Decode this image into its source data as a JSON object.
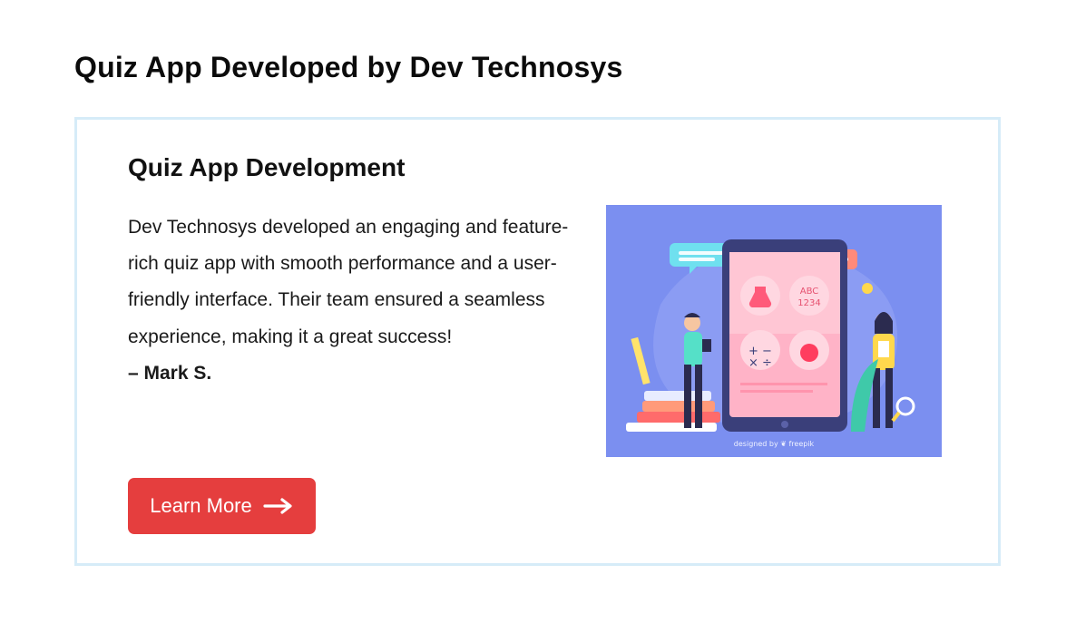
{
  "page": {
    "title": "Quiz App Developed by Dev Technosys"
  },
  "card": {
    "title": "Quiz App Development",
    "body": "Dev Technosys developed an engaging and feature-rich quiz app with smooth performance and a user-friendly interface. Their team ensured a seamless experience, making it a great success!",
    "author": "– Mark S.",
    "cta_label": "Learn More",
    "cta_icon": "arrow-right-icon"
  },
  "illustration": {
    "tile_text_top": "ABC",
    "tile_text_bottom": "1234",
    "credit": "designed by ❦ freepik"
  },
  "colors": {
    "accent": "#e53e3e",
    "card_border": "#d6ecf8",
    "illustration_bg": "#7b8ff0"
  }
}
